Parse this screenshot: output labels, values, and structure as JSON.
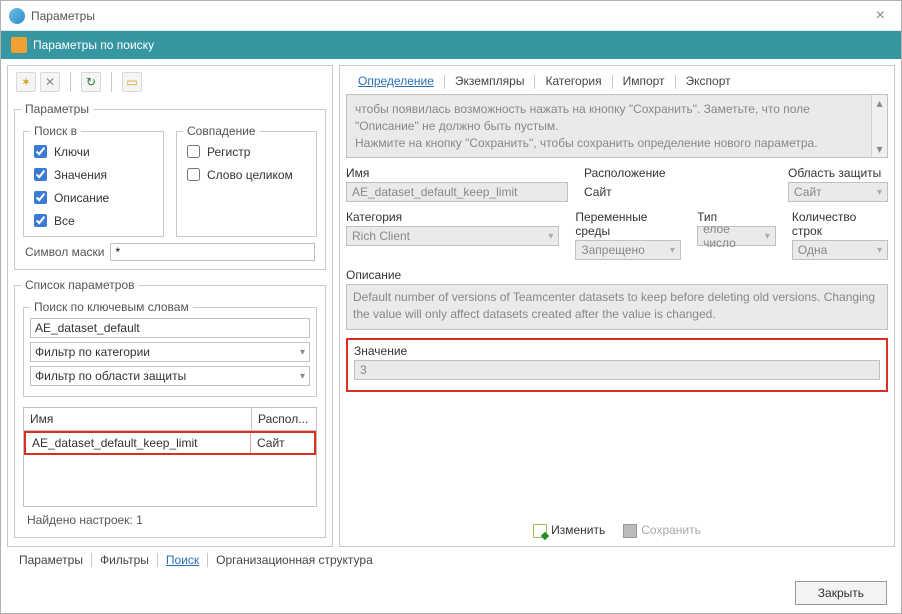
{
  "window": {
    "title": "Параметры"
  },
  "subtitle": "Параметры по поиску",
  "left": {
    "group_params": "Параметры",
    "group_search_in": "Поиск в",
    "group_match": "Совпадение",
    "checks": {
      "keys": "Ключи",
      "values": "Значения",
      "desc": "Описание",
      "all": "Все",
      "case": "Регистр",
      "whole": "Слово целиком"
    },
    "mask_label": "Символ маски",
    "mask_value": "*",
    "group_param_list": "Список параметров",
    "group_keyword": "Поиск по ключевым словам",
    "keyword_value": "AE_dataset_default",
    "filter_category": "Фильтр по категории",
    "filter_scope": "Фильтр по области защиты",
    "table": {
      "col_name": "Имя",
      "col_loc": "Распол...",
      "rows": [
        {
          "name": "AE_dataset_default_keep_limit",
          "loc": "Сайт"
        }
      ]
    },
    "found": "Найдено настроек: 1"
  },
  "tabs": {
    "t1": "Определение",
    "t2": "Экземпляры",
    "t3": "Категория",
    "t4": "Импорт",
    "t5": "Экспорт"
  },
  "info": {
    "line1": "чтобы появилась возможность нажать на кнопку \"Сохранить\". Заметьте, что поле \"Описание\" не должно быть пустым.",
    "line2": "Нажмите на кнопку \"Сохранить\", чтобы сохранить определение нового параметра."
  },
  "fields": {
    "name_label": "Имя",
    "name_value": "AE_dataset_default_keep_limit",
    "location_label": "Расположение",
    "location_value": "Сайт",
    "scope_label": "Область защиты",
    "scope_value": "Сайт",
    "category_label": "Категория",
    "category_value": "Rich Client",
    "env_label": "Переменные среды",
    "env_value": "Запрещено",
    "type_label": "Тип",
    "type_value": "елое число",
    "rows_label": "Количество строк",
    "rows_value": "Одна",
    "desc_label": "Описание",
    "desc_value": "Default number of versions of Teamcenter datasets to keep before deleting old versions.  Changing the value will only affect datasets created after the value is changed.",
    "value_label": "Значение",
    "value_value": "3"
  },
  "actions": {
    "edit": "Изменить",
    "save": "Сохранить"
  },
  "bottom_tabs": {
    "t1": "Параметры",
    "t2": "Фильтры",
    "t3": "Поиск",
    "t4": "Организационная структура"
  },
  "footer": {
    "close": "Закрыть"
  }
}
